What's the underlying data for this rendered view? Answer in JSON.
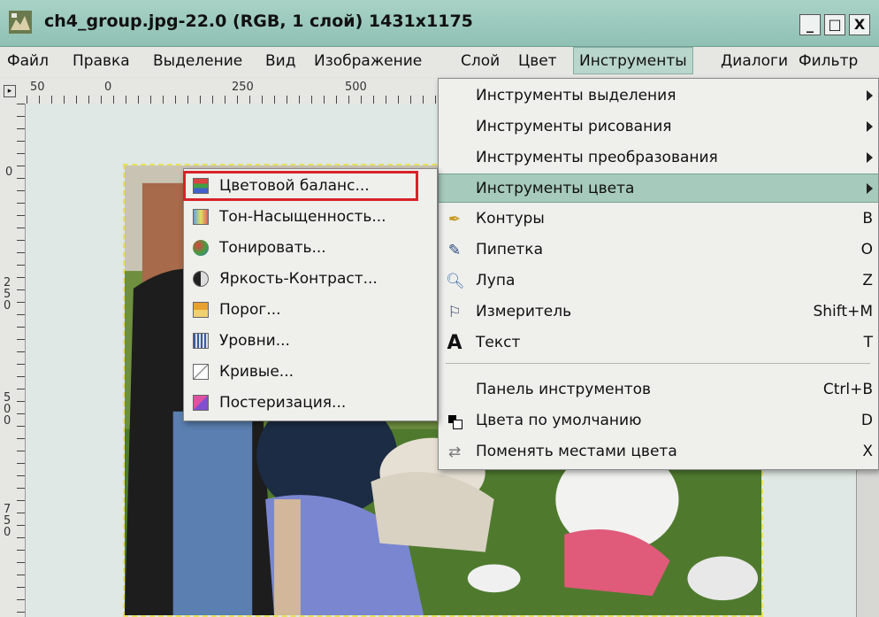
{
  "window": {
    "title": "ch4_group.jpg-22.0 (RGB, 1 слой) 1431x1175",
    "min_label": "_",
    "max_label": "□",
    "close_label": "X"
  },
  "menubar": {
    "items": [
      "Файл",
      "Правка",
      "Выделение",
      "Вид",
      "Изображение",
      "Слой",
      "Цвет",
      "Инструменты",
      "Диалоги",
      "Фильтр"
    ]
  },
  "rulers": {
    "h_labels": [
      "50",
      "0",
      "250",
      "500"
    ],
    "v_labels": [
      "0",
      "250",
      "500",
      "750"
    ]
  },
  "tools_menu": {
    "items": [
      {
        "label": "Инструменты выделения",
        "submenu": true
      },
      {
        "label": "Инструменты рисования",
        "submenu": true
      },
      {
        "label": "Инструменты преобразования",
        "submenu": true
      },
      {
        "label": "Инструменты цвета",
        "submenu": true,
        "highlighted": true
      },
      {
        "label": "Контуры",
        "shortcut": "B",
        "icon": "paths-icon"
      },
      {
        "label": "Пипетка",
        "shortcut": "O",
        "icon": "color-picker-icon"
      },
      {
        "label": "Лупа",
        "shortcut": "Z",
        "icon": "magnify-icon"
      },
      {
        "label": "Измеритель",
        "shortcut": "Shift+M",
        "icon": "measure-icon"
      },
      {
        "label": "Текст",
        "shortcut": "T",
        "icon": "text-icon"
      },
      {
        "label": "Панель инструментов",
        "shortcut": "Ctrl+B"
      },
      {
        "label": "Цвета по умолчанию",
        "shortcut": "D",
        "icon": "default-colors-icon"
      },
      {
        "label": "Поменять местами цвета",
        "shortcut": "X",
        "icon": "swap-colors-icon"
      }
    ]
  },
  "color_tools_submenu": {
    "items": [
      {
        "label": "Цветовой баланс...",
        "icon": "color-balance-icon",
        "boxed": true
      },
      {
        "label": "Тон-Насыщенность...",
        "icon": "hue-saturation-icon"
      },
      {
        "label": "Тонировать...",
        "icon": "colorize-icon"
      },
      {
        "label": "Яркость-Контраст...",
        "icon": "brightness-contrast-icon"
      },
      {
        "label": "Порог...",
        "icon": "threshold-icon"
      },
      {
        "label": "Уровни...",
        "icon": "levels-icon"
      },
      {
        "label": "Кривые...",
        "icon": "curves-icon"
      },
      {
        "label": "Постеризация...",
        "icon": "posterize-icon"
      }
    ]
  },
  "colors": {
    "titlebar": "#9ccabd",
    "highlight": "#a6cabc",
    "callout": "#d8222a"
  }
}
